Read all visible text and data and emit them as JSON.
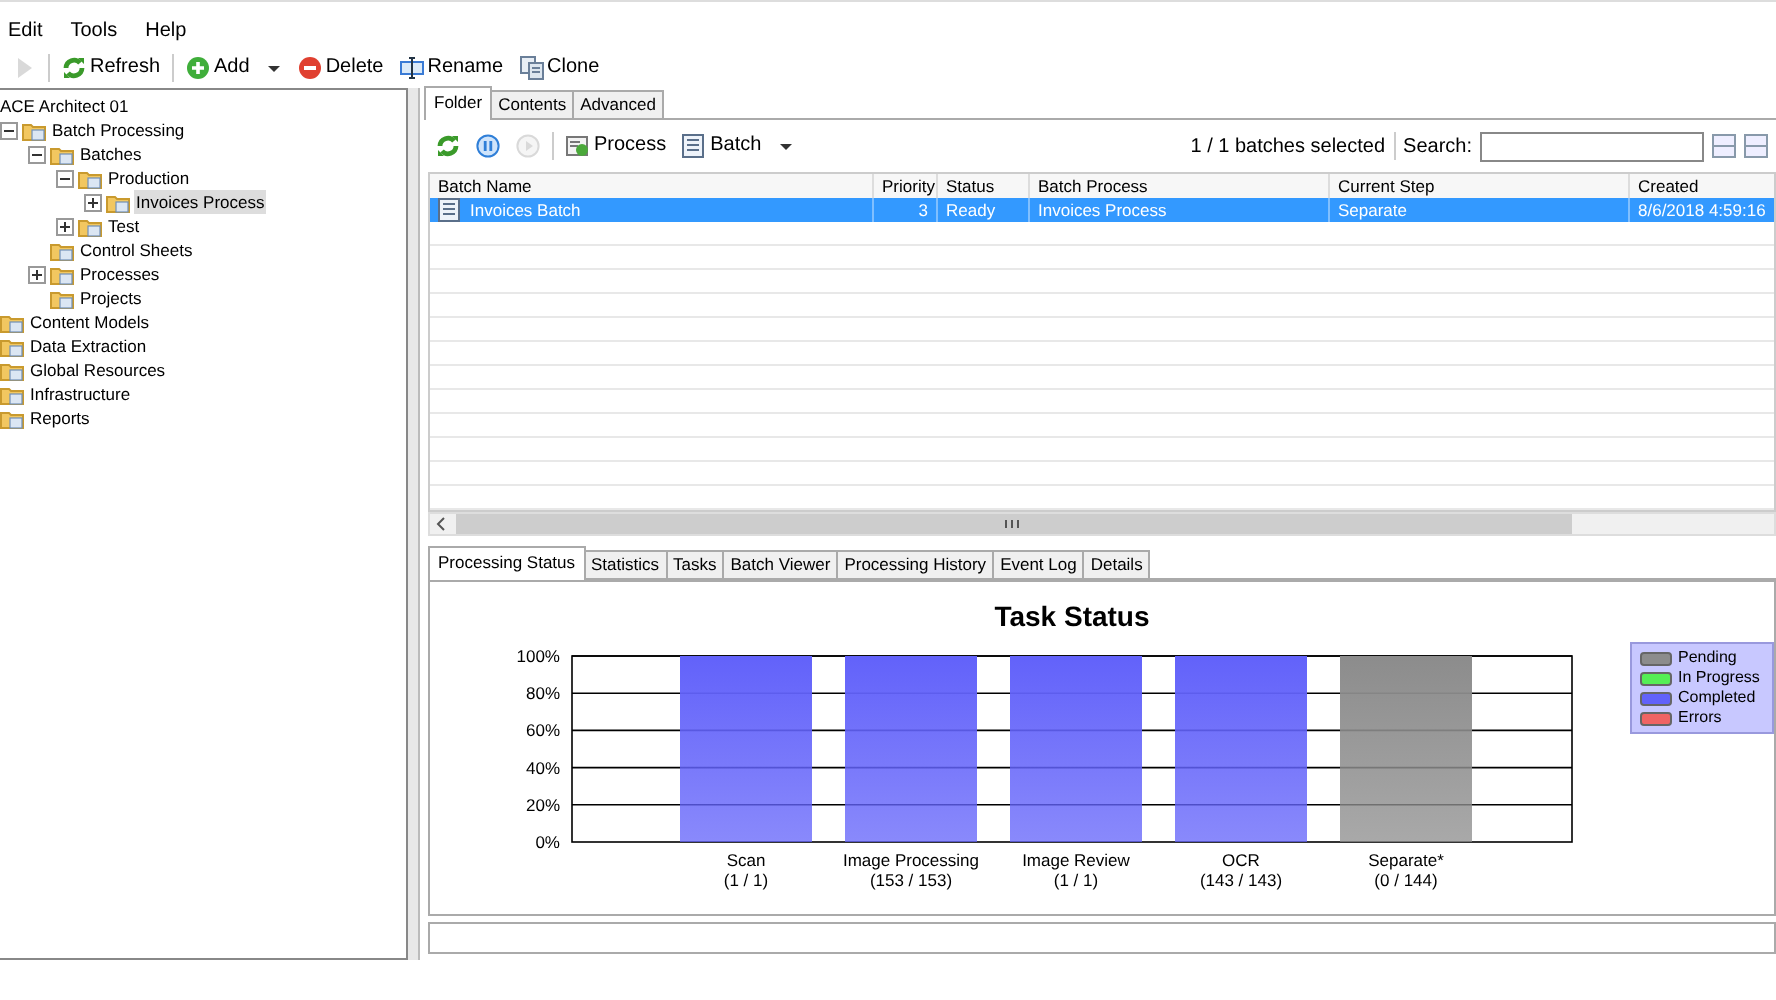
{
  "menu": [
    "Edit",
    "Tools",
    "Help"
  ],
  "toolbar": [
    {
      "kind": "play",
      "disabled": true
    },
    {
      "kind": "refresh",
      "label": "Refresh"
    },
    {
      "kind": "add",
      "label": "Add",
      "dropdown": true
    },
    {
      "kind": "delete",
      "label": "Delete"
    },
    {
      "kind": "rename",
      "label": "Rename"
    },
    {
      "kind": "clone",
      "label": "Clone"
    }
  ],
  "tree": {
    "root": "ACE Architect 01",
    "items": [
      {
        "label": "Batch Processing",
        "expanded": true,
        "selected": false,
        "children": [
          {
            "label": "Batches",
            "expanded": true,
            "selected": false,
            "children": [
              {
                "label": "Production",
                "expanded": true,
                "selected": false,
                "children": [
                  {
                    "label": "Invoices Process",
                    "expanded": false,
                    "selected": true
                  }
                ]
              },
              {
                "label": "Test",
                "expanded": false,
                "selected": false
              }
            ]
          },
          {
            "label": "Control Sheets",
            "selected": false
          },
          {
            "label": "Processes",
            "expanded": false,
            "selected": false
          },
          {
            "label": "Projects",
            "selected": false
          }
        ]
      },
      {
        "label": "Content Models",
        "selected": false
      },
      {
        "label": "Data Extraction",
        "selected": false
      },
      {
        "label": "Global Resources",
        "selected": false
      },
      {
        "label": "Infrastructure",
        "selected": false
      },
      {
        "label": "Reports",
        "selected": false
      }
    ]
  },
  "top_tabs": [
    {
      "label": "Folder",
      "selected": true
    },
    {
      "label": "Contents",
      "selected": false
    },
    {
      "label": "Advanced",
      "selected": false
    }
  ],
  "folder_toolbar": {
    "buttons": [
      {
        "kind": "refresh"
      },
      {
        "kind": "pause"
      },
      {
        "kind": "resume",
        "disabled": true
      },
      {
        "kind": "process",
        "label": "Process"
      },
      {
        "kind": "batch",
        "label": "Batch",
        "dropdown": true
      }
    ],
    "selection_count": "1 / 1 batches selected",
    "search": {
      "label": "Search:"
    }
  },
  "table": {
    "columns": [
      "Batch Name",
      "Priority",
      "Status",
      "Batch Process",
      "Current Step",
      "Created"
    ],
    "rows": [
      {
        "cells": [
          "Invoices Batch",
          "3",
          "Ready",
          "Invoices Process",
          "Separate",
          "8/6/2018 4:59:16"
        ],
        "selected": true
      }
    ]
  },
  "bottom_tabs": [
    {
      "label": "Processing Status",
      "selected": true
    },
    {
      "label": "Statistics",
      "selected": false
    },
    {
      "label": "Tasks",
      "selected": false
    },
    {
      "label": "Batch Viewer",
      "selected": false
    },
    {
      "label": "Processing History",
      "selected": false
    },
    {
      "label": "Event Log",
      "selected": false
    },
    {
      "label": "Details",
      "selected": false
    }
  ],
  "chart_data": {
    "type": "bar",
    "title": "Task Status",
    "stacked": true,
    "grid": true,
    "categories": [
      "Scan\n(1 / 1)",
      "Image Processing\n(153 / 153)",
      "Image Review\n(1 / 1)",
      "OCR\n(143 / 143)",
      "Separate*\n(0 / 144)"
    ],
    "series": [
      {
        "name": "Pending",
        "color": "#8c8c8c",
        "values": [
          0,
          0,
          0,
          0,
          100
        ]
      },
      {
        "name": "In Progress",
        "color": "#55ee55",
        "values": [
          0,
          0,
          0,
          0,
          0
        ]
      },
      {
        "name": "Completed",
        "color": "#6262fa",
        "values": [
          100,
          100,
          100,
          100,
          0
        ]
      },
      {
        "name": "Errors",
        "color": "#f06464",
        "values": [
          0,
          0,
          0,
          0,
          0
        ]
      }
    ],
    "ylim": [
      0,
      100
    ],
    "yticks": [
      {
        "value": 0,
        "label": "0%"
      },
      {
        "value": 20,
        "label": "20%"
      },
      {
        "value": 40,
        "label": "40%"
      },
      {
        "value": 60,
        "label": "60%"
      },
      {
        "value": 80,
        "label": "80%"
      },
      {
        "value": 100,
        "label": "100%"
      }
    ]
  }
}
